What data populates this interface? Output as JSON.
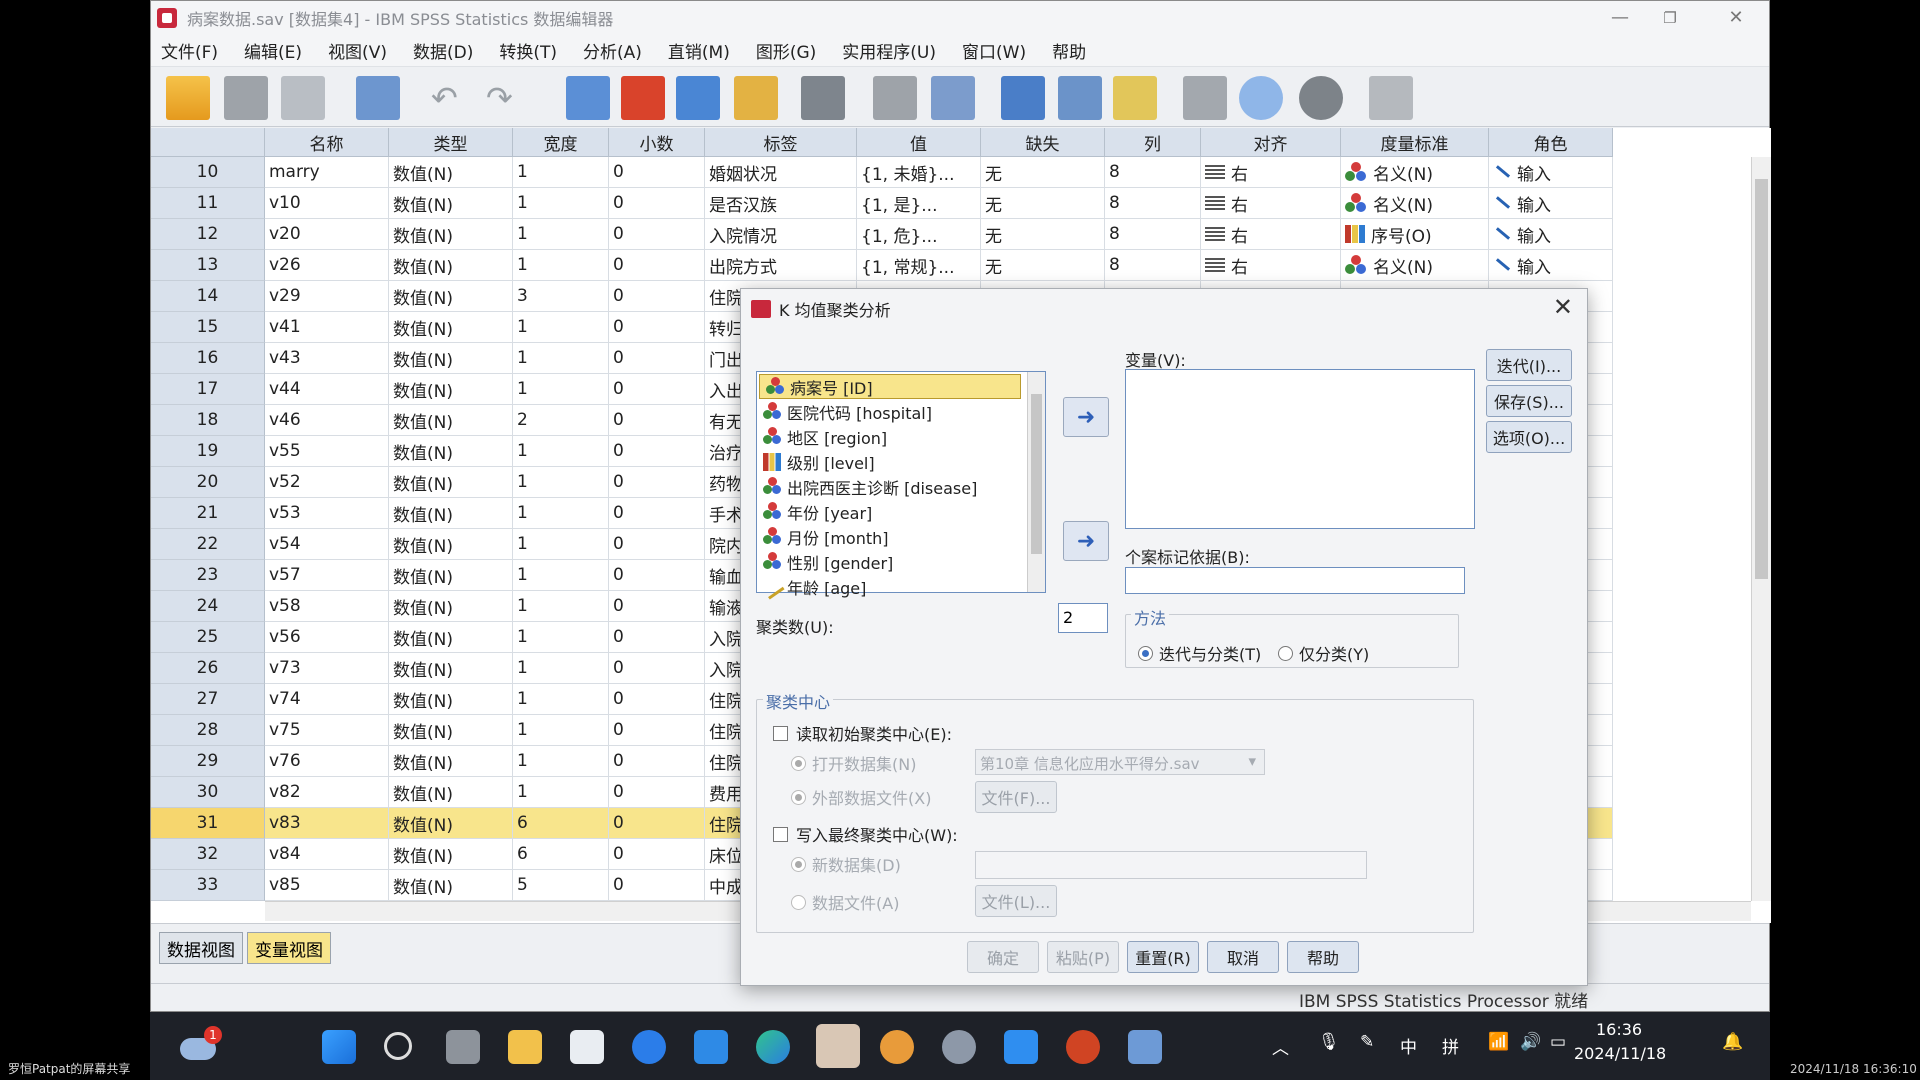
{
  "window": {
    "title": "病案数据.sav [数据集4] - IBM SPSS Statistics 数据编辑器",
    "controls": {
      "min": "—",
      "restore": "❐",
      "close": "✕"
    }
  },
  "menu": [
    "文件(F)",
    "编辑(E)",
    "视图(V)",
    "数据(D)",
    "转换(T)",
    "分析(A)",
    "直销(M)",
    "图形(G)",
    "实用程序(U)",
    "窗口(W)",
    "帮助"
  ],
  "toolbar_icons": [
    "open-icon",
    "save-icon",
    "print-icon",
    "recall-dialog-icon",
    "undo-icon",
    "redo-icon",
    "goto-case-icon",
    "goto-variable-icon",
    "variables-icon",
    "run-icon",
    "find-icon",
    "insert-cases-icon",
    "insert-variable-icon",
    "split-file-icon",
    "weight-cases-icon",
    "select-cases-icon",
    "value-labels-icon",
    "use-sets-icon",
    "show-all-icon",
    "spell-icon"
  ],
  "grid": {
    "headers": [
      "名称",
      "类型",
      "宽度",
      "小数",
      "标签",
      "值",
      "缺失",
      "列",
      "对齐",
      "度量标准",
      "角色"
    ],
    "rows": [
      {
        "n": "10",
        "name": "marry",
        "type": "数值(N)",
        "width": "1",
        "dec": "0",
        "label": "婚姻状况",
        "values": "{1, 未婚}...",
        "missing": "无",
        "col": "8",
        "align": "右",
        "measure": "名义(N)",
        "mtype": "nom",
        "role": "输入"
      },
      {
        "n": "11",
        "name": "v10",
        "type": "数值(N)",
        "width": "1",
        "dec": "0",
        "label": "是否汉族",
        "values": "{1, 是}...",
        "missing": "无",
        "col": "8",
        "align": "右",
        "measure": "名义(N)",
        "mtype": "nom",
        "role": "输入"
      },
      {
        "n": "12",
        "name": "v20",
        "type": "数值(N)",
        "width": "1",
        "dec": "0",
        "label": "入院情况",
        "values": "{1, 危}...",
        "missing": "无",
        "col": "8",
        "align": "右",
        "measure": "序号(O)",
        "mtype": "ord",
        "role": "输入"
      },
      {
        "n": "13",
        "name": "v26",
        "type": "数值(N)",
        "width": "1",
        "dec": "0",
        "label": "出院方式",
        "values": "{1, 常规}...",
        "missing": "无",
        "col": "8",
        "align": "右",
        "measure": "名义(N)",
        "mtype": "nom",
        "role": "输入"
      },
      {
        "n": "14",
        "name": "v29",
        "type": "数值(N)",
        "width": "3",
        "dec": "0",
        "label": "住院"
      },
      {
        "n": "15",
        "name": "v41",
        "type": "数值(N)",
        "width": "1",
        "dec": "0",
        "label": "转归"
      },
      {
        "n": "16",
        "name": "v43",
        "type": "数值(N)",
        "width": "1",
        "dec": "0",
        "label": "门出"
      },
      {
        "n": "17",
        "name": "v44",
        "type": "数值(N)",
        "width": "1",
        "dec": "0",
        "label": "入出"
      },
      {
        "n": "18",
        "name": "v46",
        "type": "数值(N)",
        "width": "2",
        "dec": "0",
        "label": "有无"
      },
      {
        "n": "19",
        "name": "v55",
        "type": "数值(N)",
        "width": "1",
        "dec": "0",
        "label": "治疗"
      },
      {
        "n": "20",
        "name": "v52",
        "type": "数值(N)",
        "width": "1",
        "dec": "0",
        "label": "药物"
      },
      {
        "n": "21",
        "name": "v53",
        "type": "数值(N)",
        "width": "1",
        "dec": "0",
        "label": "手术"
      },
      {
        "n": "22",
        "name": "v54",
        "type": "数值(N)",
        "width": "1",
        "dec": "0",
        "label": "院内"
      },
      {
        "n": "23",
        "name": "v57",
        "type": "数值(N)",
        "width": "1",
        "dec": "0",
        "label": "输血"
      },
      {
        "n": "24",
        "name": "v58",
        "type": "数值(N)",
        "width": "1",
        "dec": "0",
        "label": "输液"
      },
      {
        "n": "25",
        "name": "v56",
        "type": "数值(N)",
        "width": "1",
        "dec": "0",
        "label": "入院"
      },
      {
        "n": "26",
        "name": "v73",
        "type": "数值(N)",
        "width": "1",
        "dec": "0",
        "label": "入院"
      },
      {
        "n": "27",
        "name": "v74",
        "type": "数值(N)",
        "width": "1",
        "dec": "0",
        "label": "住院"
      },
      {
        "n": "28",
        "name": "v75",
        "type": "数值(N)",
        "width": "1",
        "dec": "0",
        "label": "住院"
      },
      {
        "n": "29",
        "name": "v76",
        "type": "数值(N)",
        "width": "1",
        "dec": "0",
        "label": "住院"
      },
      {
        "n": "30",
        "name": "v82",
        "type": "数值(N)",
        "width": "1",
        "dec": "0",
        "label": "费用"
      },
      {
        "n": "31",
        "name": "v83",
        "type": "数值(N)",
        "width": "6",
        "dec": "0",
        "label": "住院",
        "selected": true
      },
      {
        "n": "32",
        "name": "v84",
        "type": "数值(N)",
        "width": "6",
        "dec": "0",
        "label": "床位"
      },
      {
        "n": "33",
        "name": "v85",
        "type": "数值(N)",
        "width": "5",
        "dec": "0",
        "label": "中成"
      }
    ]
  },
  "tabs": {
    "data_view": "数据视图",
    "variable_view": "变量视图"
  },
  "status": "IBM SPSS Statistics Processor 就绪",
  "dialog": {
    "title": "K 均值聚类分析",
    "close": "✕",
    "source_vars": [
      {
        "label": "病案号 [ID]",
        "mtype": "nom",
        "selected": true
      },
      {
        "label": "医院代码 [hospital]",
        "mtype": "nom"
      },
      {
        "label": "地区 [region]",
        "mtype": "nom"
      },
      {
        "label": "级别 [level]",
        "mtype": "ord"
      },
      {
        "label": "出院西医主诊断 [disease]",
        "mtype": "nom"
      },
      {
        "label": "年份 [year]",
        "mtype": "nom"
      },
      {
        "label": "月份 [month]",
        "mtype": "nom"
      },
      {
        "label": "性别 [gender]",
        "mtype": "nom"
      },
      {
        "label": "年龄 [age]",
        "mtype": "scale"
      }
    ],
    "variables_label": "变量(V):",
    "case_label_label": "个案标记依据(B):",
    "buttons_right": [
      "迭代(I)...",
      "保存(S)...",
      "选项(O)..."
    ],
    "num_clusters_label": "聚类数(U):",
    "num_clusters_value": "2",
    "method": {
      "title": "方法",
      "opt1": "迭代与分类(T)",
      "opt2": "仅分类(Y)"
    },
    "centers": {
      "title": "聚类中心",
      "read_initial": "读取初始聚类中心(E):",
      "open_dataset": "打开数据集(N)",
      "dataset_value": "第10章 信息化应用水平得分.sav",
      "external_file": "外部数据文件(X)",
      "file_btn1": "文件(F)...",
      "write_final": "写入最终聚类中心(W):",
      "new_dataset": "新数据集(D)",
      "data_file": "数据文件(A)",
      "file_btn2": "文件(L)..."
    },
    "bottom_buttons": [
      "确定",
      "粘贴(P)",
      "重置(R)",
      "取消",
      "帮助"
    ]
  },
  "taskbar": {
    "notification_badge": "1",
    "time": "16:36",
    "date": "2024/11/18",
    "ime1": "中",
    "ime2": "拼"
  },
  "overlay": {
    "share": "罗恒Patpat的屏幕共享",
    "stamp": "2024/11/18 16:36:10"
  }
}
